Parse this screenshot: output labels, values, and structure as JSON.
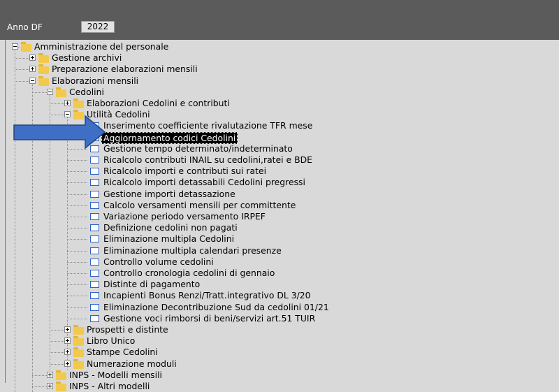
{
  "header": {
    "year_label": "Anno DF",
    "year_value": "2022"
  },
  "tree": [
    {
      "label": "Amministrazione del personale",
      "level": 0,
      "type": "folder",
      "expander": "minus"
    },
    {
      "label": "Gestione archivi",
      "level": 1,
      "type": "folder",
      "expander": "plus"
    },
    {
      "label": "Preparazione elaborazioni mensili",
      "level": 1,
      "type": "folder",
      "expander": "plus"
    },
    {
      "label": "Elaborazioni mensili",
      "level": 1,
      "type": "folder",
      "expander": "minus"
    },
    {
      "label": "Cedolini",
      "level": 2,
      "type": "folder",
      "expander": "minus"
    },
    {
      "label": "Elaborazioni Cedolini e contributi",
      "level": 3,
      "type": "folder",
      "expander": "plus"
    },
    {
      "label": "Utilità Cedolini",
      "level": 3,
      "type": "folder",
      "expander": "minus"
    },
    {
      "label": "Inserimento coefficiente rivalutazione TFR mese",
      "level": 4,
      "type": "doc"
    },
    {
      "label": "Aggiornamento codici Cedolini",
      "level": 4,
      "type": "doc",
      "selected": true
    },
    {
      "label": "Gestione tempo determinato/indeterminato",
      "level": 4,
      "type": "doc"
    },
    {
      "label": "Ricalcolo contributi INAIL su cedolini,ratei e BDE",
      "level": 4,
      "type": "doc"
    },
    {
      "label": "Ricalcolo importi e contributi sui ratei",
      "level": 4,
      "type": "doc"
    },
    {
      "label": "Ricalcolo importi detassabili Cedolini pregressi",
      "level": 4,
      "type": "doc"
    },
    {
      "label": "Gestione importi detassazione",
      "level": 4,
      "type": "doc"
    },
    {
      "label": "Calcolo versamenti mensili per committente",
      "level": 4,
      "type": "doc"
    },
    {
      "label": "Variazione periodo versamento IRPEF",
      "level": 4,
      "type": "doc"
    },
    {
      "label": "Definizione cedolini non pagati",
      "level": 4,
      "type": "doc"
    },
    {
      "label": "Eliminazione multipla Cedolini",
      "level": 4,
      "type": "doc"
    },
    {
      "label": "Eliminazione multipla calendari presenze",
      "level": 4,
      "type": "doc"
    },
    {
      "label": "Controllo volume cedolini",
      "level": 4,
      "type": "doc"
    },
    {
      "label": "Controllo cronologia cedolini di gennaio",
      "level": 4,
      "type": "doc"
    },
    {
      "label": "Distinte di pagamento",
      "level": 4,
      "type": "doc"
    },
    {
      "label": "Incapienti Bonus Renzi/Tratt.integrativo DL 3/20",
      "level": 4,
      "type": "doc"
    },
    {
      "label": "Eliminazione Decontribuzione Sud da cedolini 01/21",
      "level": 4,
      "type": "doc"
    },
    {
      "label": "Gestione voci rimborsi di beni/servizi art.51 TUIR",
      "level": 4,
      "type": "doc"
    },
    {
      "label": "Prospetti e distinte",
      "level": 3,
      "type": "folder",
      "expander": "plus"
    },
    {
      "label": "Libro Unico",
      "level": 3,
      "type": "folder",
      "expander": "plus"
    },
    {
      "label": "Stampe Cedolini",
      "level": 3,
      "type": "folder",
      "expander": "plus"
    },
    {
      "label": "Numerazione moduli",
      "level": 3,
      "type": "folder",
      "expander": "plus"
    },
    {
      "label": "INPS - Modelli mensili",
      "level": 2,
      "type": "folder",
      "expander": "plus"
    },
    {
      "label": "INPS - Altri modelli",
      "level": 2,
      "type": "folder",
      "expander": "plus"
    }
  ],
  "colors": {
    "arrow_fill": "#3f6fc4",
    "arrow_stroke": "#25467f",
    "folder": "#f2c94c",
    "doc_border": "#2b63c6"
  },
  "icons": {
    "folder": "folder-icon",
    "document": "document-icon",
    "expander": "tree-expander-icon",
    "pointer": "blue-arrow-icon"
  }
}
